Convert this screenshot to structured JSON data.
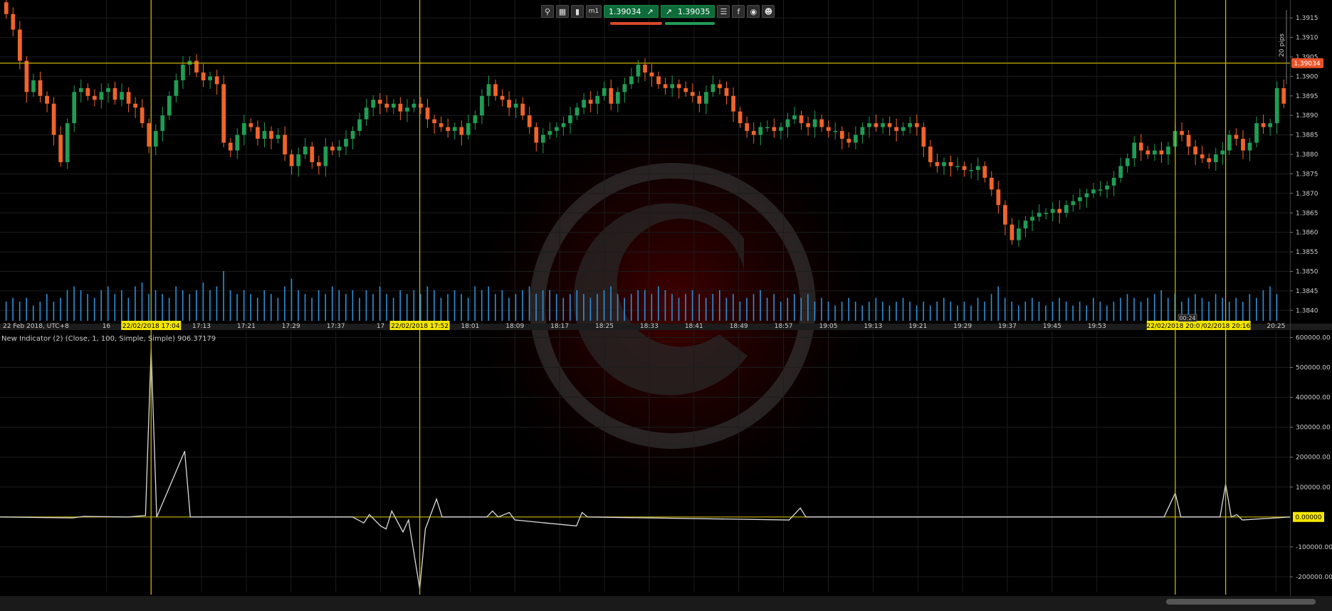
{
  "toolbar": {
    "icons": [
      "zoom-icon",
      "chart-settings-icon",
      "candles-icon",
      "timeframe-icon"
    ],
    "timeframe_label": "m1",
    "sell_price": "1.39034",
    "buy_price": "1.39035",
    "right_icons": [
      "list-icon",
      "facebook-icon",
      "share-icon",
      "profile-icon"
    ]
  },
  "indicator_title": "New Indicator (2) (Close, 1, 100, Simple, Simple) 906.37179",
  "pips_label": "20 pips",
  "current_price_label": "1.39034",
  "indicator_zero_label": "0.00000",
  "small_tag": "00:24",
  "colors": {
    "up": "#1f9d55",
    "down": "#f0642a",
    "volume": "#2f8fd6",
    "crosshair": "#c8b400",
    "line": "#dcdcdc"
  },
  "chart_data": [
    {
      "type": "candlestick",
      "symbol_date_label": "22 Feb 2018, UTC+8",
      "y_ticks": [
        "1.3915",
        "1.3910",
        "1.3905",
        "1.3900",
        "1.3895",
        "1.3890",
        "1.3885",
        "1.3880",
        "1.3875",
        "1.3870",
        "1.3865",
        "1.3860",
        "1.3855",
        "1.3850",
        "1.3845",
        "1.3840"
      ],
      "ylim": [
        1.38375,
        1.39185
      ],
      "x_ticks": [
        "16",
        "17:13",
        "17:21",
        "17:29",
        "17:37",
        "17",
        "18:01",
        "18:09",
        "18:17",
        "18:25",
        "18:33",
        "18:41",
        "18:49",
        "18:57",
        "19:05",
        "19:13",
        "19:21",
        "19:29",
        "19:37",
        "19:45",
        "19:53",
        "20:25"
      ],
      "x_tick_minutes": [
        1016,
        1033,
        1041,
        1049,
        1057,
        1065,
        1081,
        1089,
        1097,
        1105,
        1113,
        1121,
        1129,
        1137,
        1145,
        1153,
        1161,
        1169,
        1177,
        1185,
        1193,
        1225
      ],
      "x_range_minutes": [
        997,
        1227.5
      ],
      "marker_labels": [
        "22/02/2018 17:04",
        "22/02/2018 17:52",
        "22/02/2018 20:07",
        "/02/2018 20:16"
      ],
      "marker_minutes": [
        1024,
        1072,
        1207,
        1216
      ],
      "horizontal_line": 1.39034,
      "close": [
        1.3916,
        1.3912,
        1.3904,
        1.3896,
        1.3899,
        1.3895,
        1.3893,
        1.3885,
        1.3878,
        1.3888,
        1.3896,
        1.3897,
        1.3895,
        1.3894,
        1.3896,
        1.3897,
        1.3894,
        1.3896,
        1.3893,
        1.3892,
        1.3888,
        1.3882,
        1.3886,
        1.389,
        1.3895,
        1.3899,
        1.3903,
        1.3904,
        1.3901,
        1.3899,
        1.39,
        1.3898,
        1.3883,
        1.3881,
        1.3885,
        1.3888,
        1.3887,
        1.3884,
        1.3886,
        1.3884,
        1.3885,
        1.388,
        1.3877,
        1.388,
        1.3882,
        1.3878,
        1.3877,
        1.3882,
        1.3881,
        1.3882,
        1.3884,
        1.3886,
        1.3889,
        1.3892,
        1.3894,
        1.3893,
        1.3892,
        1.3893,
        1.3891,
        1.3892,
        1.3893,
        1.3892,
        1.3889,
        1.3888,
        1.3887,
        1.3886,
        1.3887,
        1.3885,
        1.3888,
        1.389,
        1.3895,
        1.3898,
        1.3895,
        1.3894,
        1.3892,
        1.3893,
        1.389,
        1.3887,
        1.3883,
        1.3885,
        1.3886,
        1.3887,
        1.3888,
        1.389,
        1.3892,
        1.3894,
        1.3893,
        1.3895,
        1.3897,
        1.3893,
        1.3896,
        1.3898,
        1.39,
        1.3903,
        1.3901,
        1.39,
        1.3898,
        1.3897,
        1.3898,
        1.3897,
        1.3896,
        1.3895,
        1.3893,
        1.3896,
        1.3898,
        1.3897,
        1.3895,
        1.3891,
        1.3888,
        1.3886,
        1.3885,
        1.3887,
        1.3887,
        1.3886,
        1.3887,
        1.3889,
        1.389,
        1.3888,
        1.3887,
        1.3889,
        1.3887,
        1.3886,
        1.3886,
        1.3884,
        1.3883,
        1.3885,
        1.3887,
        1.3888,
        1.3887,
        1.3888,
        1.3887,
        1.3886,
        1.3887,
        1.3888,
        1.3887,
        1.3882,
        1.3878,
        1.3877,
        1.3878,
        1.3877,
        1.3877,
        1.3876,
        1.3876,
        1.3877,
        1.3874,
        1.3871,
        1.3867,
        1.3862,
        1.3858,
        1.3861,
        1.3863,
        1.3864,
        1.3865,
        1.3865,
        1.3866,
        1.3865,
        1.3867,
        1.3868,
        1.3869,
        1.387,
        1.3871,
        1.3871,
        1.3872,
        1.3874,
        1.3877,
        1.3879,
        1.3883,
        1.3881,
        1.388,
        1.3881,
        1.388,
        1.3882,
        1.3886,
        1.3885,
        1.3882,
        1.388,
        1.3879,
        1.3878,
        1.388,
        1.3881,
        1.3885,
        1.3884,
        1.3881,
        1.3883,
        1.3888,
        1.3887,
        1.3888,
        1.3897,
        1.3893
      ],
      "volume": [
        5,
        6,
        5,
        6,
        4,
        5,
        7,
        5,
        6,
        8,
        9,
        8,
        7,
        6,
        8,
        9,
        7,
        8,
        6,
        9,
        10,
        7,
        8,
        7,
        6,
        9,
        8,
        7,
        8,
        10,
        8,
        9,
        13,
        8,
        7,
        8,
        7,
        6,
        8,
        7,
        6,
        9,
        11,
        8,
        7,
        6,
        8,
        7,
        9,
        8,
        7,
        8,
        6,
        8,
        7,
        9,
        7,
        6,
        8,
        7,
        8,
        7,
        9,
        8,
        6,
        7,
        8,
        7,
        6,
        9,
        8,
        9,
        7,
        8,
        6,
        7,
        8,
        9,
        7,
        8,
        8,
        7,
        6,
        7,
        8,
        7,
        6,
        7,
        8,
        9,
        7,
        6,
        7,
        8,
        8,
        7,
        9,
        8,
        7,
        6,
        7,
        8,
        7,
        6,
        7,
        8,
        6,
        7,
        5,
        6,
        7,
        8,
        6,
        7,
        5,
        6,
        7,
        6,
        7,
        5,
        6,
        5,
        4,
        5,
        6,
        5,
        4,
        5,
        6,
        5,
        4,
        5,
        6,
        5,
        4,
        5,
        4,
        5,
        6,
        5,
        4,
        5,
        4,
        6,
        5,
        7,
        9,
        6,
        5,
        4,
        5,
        6,
        5,
        4,
        5,
        6,
        5,
        4,
        5,
        4,
        6,
        5,
        4,
        5,
        6,
        7,
        6,
        5,
        6,
        7,
        8,
        6,
        7,
        5,
        6,
        7,
        6,
        5,
        7,
        6,
        5,
        6,
        5,
        7,
        6,
        8,
        9,
        7
      ]
    },
    {
      "type": "line",
      "name": "New Indicator (2)",
      "y_ticks": [
        "600000.00",
        "500000.00",
        "400000.00",
        "300000.00",
        "200000.00",
        "100000.00",
        "0.00000",
        "-100000.00",
        "-200000.00"
      ],
      "y_tick_values": [
        600000,
        500000,
        400000,
        300000,
        200000,
        100000,
        0,
        -100000,
        -200000
      ],
      "ylim": [
        -250000,
        620000
      ],
      "x_range_minutes": [
        997,
        1227.5
      ],
      "points": [
        [
          997,
          0
        ],
        [
          1010,
          -3000
        ],
        [
          1012,
          2000
        ],
        [
          1020,
          0
        ],
        [
          1023,
          5000
        ],
        [
          1024,
          560000
        ],
        [
          1025,
          0
        ],
        [
          1030,
          220000
        ],
        [
          1031,
          0
        ],
        [
          1060,
          0
        ],
        [
          1062,
          -20000
        ],
        [
          1063,
          8000
        ],
        [
          1065,
          -30000
        ],
        [
          1066,
          -40000
        ],
        [
          1067,
          20000
        ],
        [
          1069,
          -50000
        ],
        [
          1070,
          -10000
        ],
        [
          1072,
          -240000
        ],
        [
          1073,
          -40000
        ],
        [
          1074,
          10000
        ],
        [
          1075,
          60000
        ],
        [
          1076,
          0
        ],
        [
          1084,
          0
        ],
        [
          1085,
          20000
        ],
        [
          1086,
          0
        ],
        [
          1088,
          15000
        ],
        [
          1089,
          -10000
        ],
        [
          1100,
          -30000
        ],
        [
          1101,
          15000
        ],
        [
          1102,
          0
        ],
        [
          1138,
          -10000
        ],
        [
          1140,
          30000
        ],
        [
          1141,
          0
        ],
        [
          1205,
          0
        ],
        [
          1207,
          80000
        ],
        [
          1208,
          0
        ],
        [
          1215,
          0
        ],
        [
          1216,
          110000
        ],
        [
          1217,
          0
        ],
        [
          1218,
          8000
        ],
        [
          1219,
          -10000
        ],
        [
          1227.5,
          0
        ]
      ]
    }
  ]
}
